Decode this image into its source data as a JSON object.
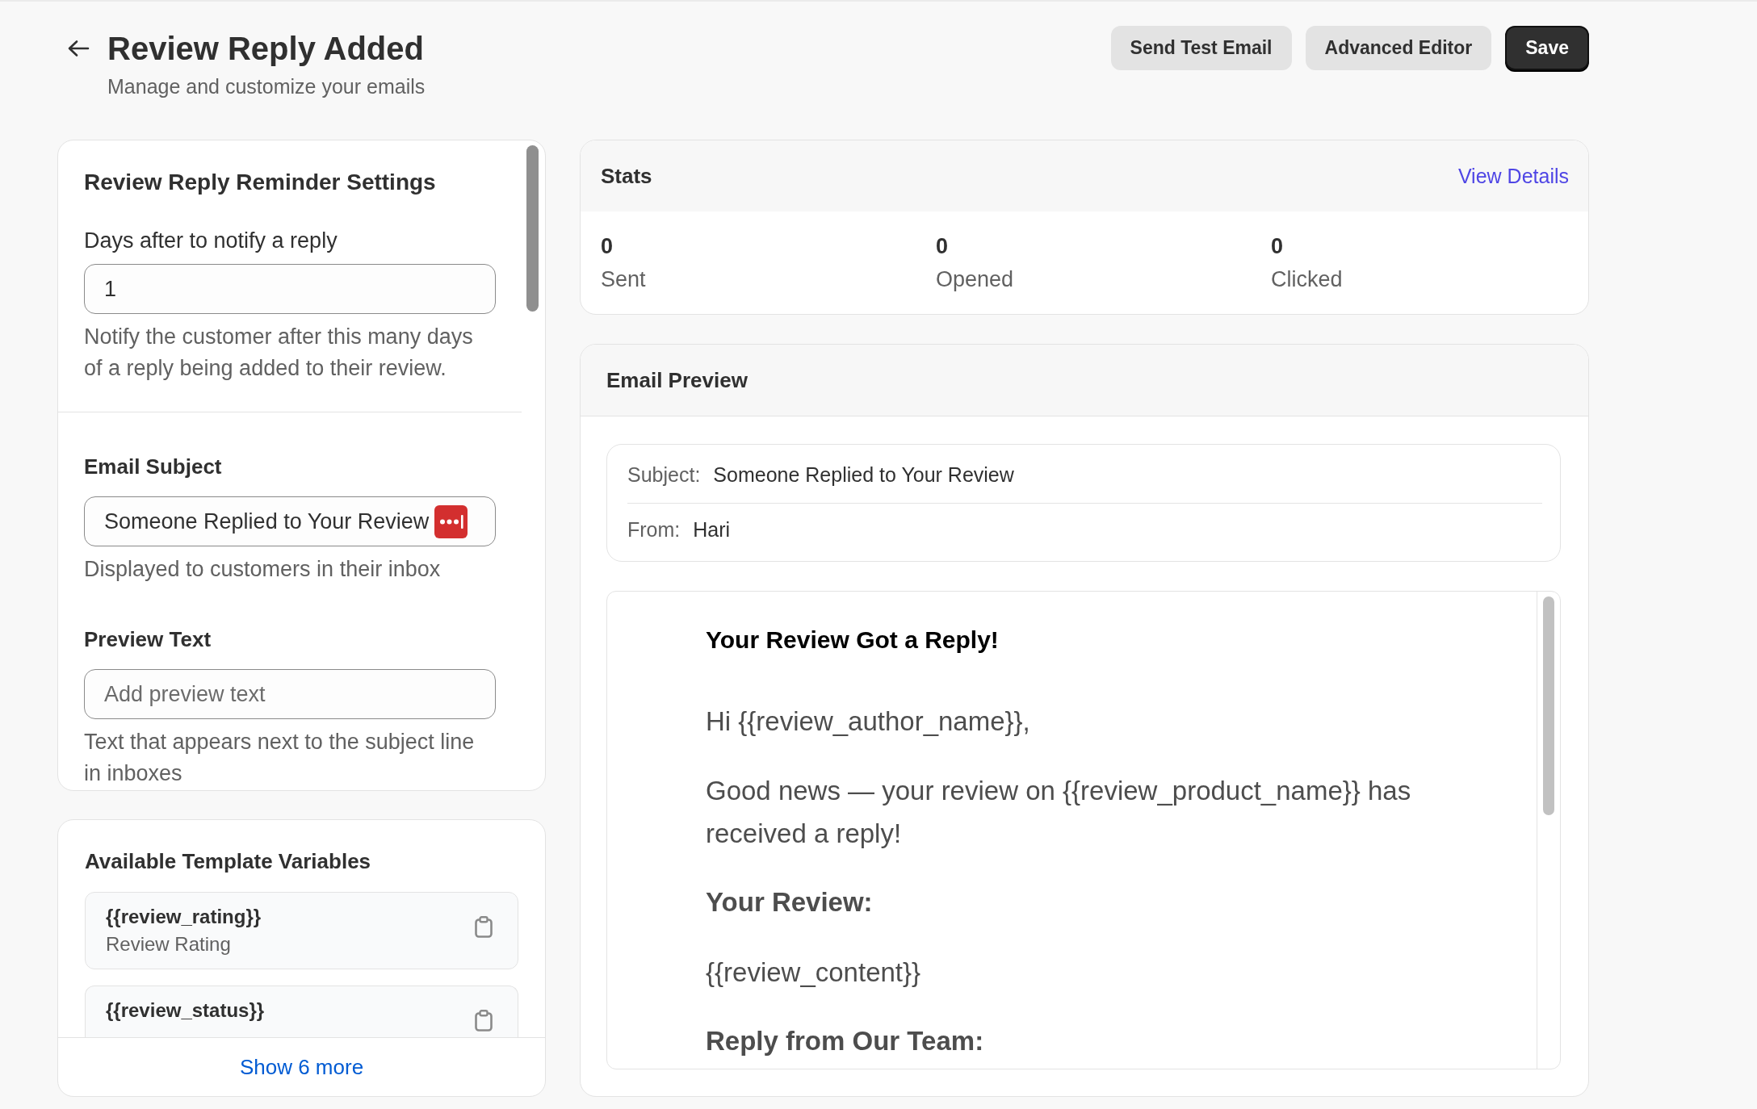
{
  "header": {
    "title": "Review Reply Added",
    "subtitle": "Manage and customize your emails",
    "buttons": [
      {
        "label": "Send Test Email",
        "kind": "secondary"
      },
      {
        "label": "Advanced Editor",
        "kind": "secondary"
      },
      {
        "label": "Save",
        "kind": "primary"
      }
    ]
  },
  "settings": {
    "sections": [
      {
        "title": "Review Reply Reminder Settings",
        "fields": [
          {
            "label": "Days after to notify a reply",
            "value": "1",
            "help": "Notify the customer after this many days of a reply being added to their review."
          }
        ]
      },
      {
        "fields": [
          {
            "label": "Email Subject",
            "value": "Someone Replied to Your Review",
            "help": "Displayed to customers in their inbox"
          },
          {
            "label": "Preview Text",
            "placeholder": "Add preview text",
            "help": "Text that appears next to the subject line in inboxes"
          }
        ]
      }
    ]
  },
  "template_variables": {
    "title": "Available Template Variables",
    "items": [
      {
        "name": "{{review_rating}}",
        "description": "Review Rating"
      },
      {
        "name": "{{review_status}}"
      }
    ],
    "show_more": "Show 6 more"
  },
  "stats": {
    "title": "Stats",
    "link": "View Details",
    "items": [
      {
        "value": "0",
        "label": "Sent"
      },
      {
        "value": "0",
        "label": "Opened"
      },
      {
        "value": "0",
        "label": "Clicked"
      }
    ]
  },
  "email_preview": {
    "title": "Email Preview",
    "meta": [
      {
        "label": "Subject:",
        "value": "Someone Replied to Your Review"
      },
      {
        "label": "From:",
        "value": "Hari"
      }
    ],
    "body": [
      {
        "kind": "title",
        "text": "Your Review Got a Reply!"
      },
      {
        "kind": "paragraph",
        "text": "Hi {{review_author_name}},"
      },
      {
        "kind": "paragraph",
        "text": "Good news — your review on {{review_product_name}} has received a reply!"
      },
      {
        "kind": "heading",
        "text": "Your Review:"
      },
      {
        "kind": "paragraph",
        "text": "{{review_content}}"
      },
      {
        "kind": "heading",
        "text": "Reply from Our Team:"
      }
    ]
  }
}
